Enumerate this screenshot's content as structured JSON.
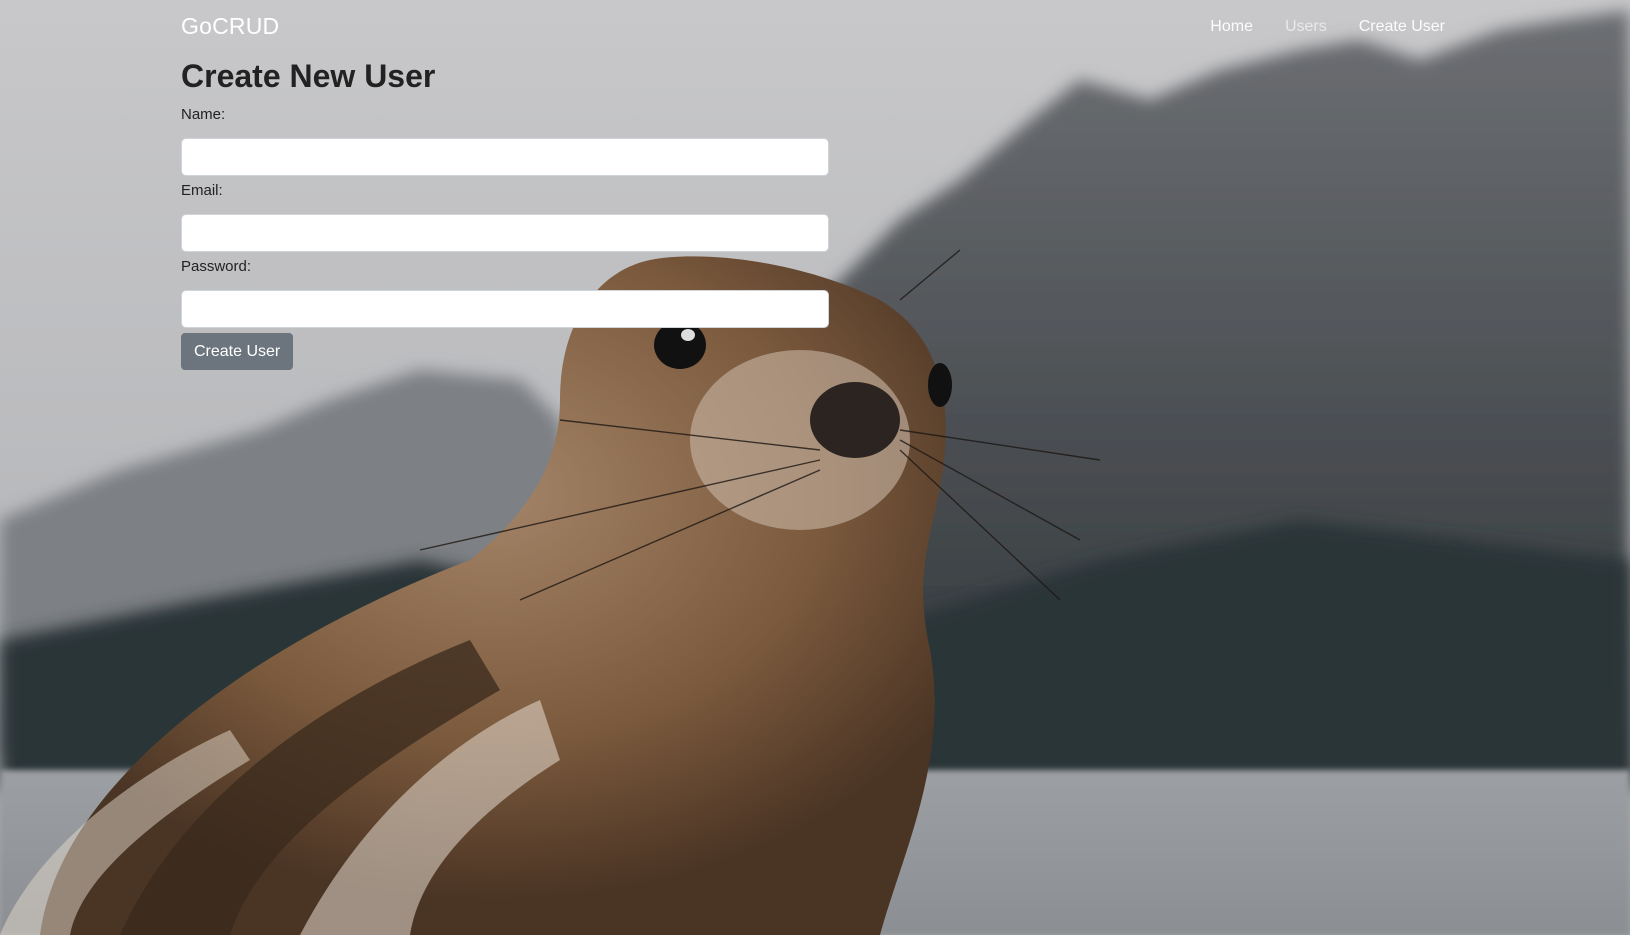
{
  "navbar": {
    "brand": "GoCRUD",
    "links": [
      {
        "label": "Home"
      },
      {
        "label": "Users"
      },
      {
        "label": "Create User"
      }
    ]
  },
  "form": {
    "title": "Create New User",
    "fields": [
      {
        "label": "Name:",
        "value": ""
      },
      {
        "label": "Email:",
        "value": ""
      },
      {
        "label": "Password:",
        "value": ""
      }
    ],
    "submit_label": "Create User"
  },
  "background": {
    "icon": "chipmunk-mountain-photo",
    "colors": {
      "sky": "#cfcfd1",
      "mountain": "#4a4e52",
      "fur": "#8a6a4c",
      "button": "#6c757d"
    }
  }
}
